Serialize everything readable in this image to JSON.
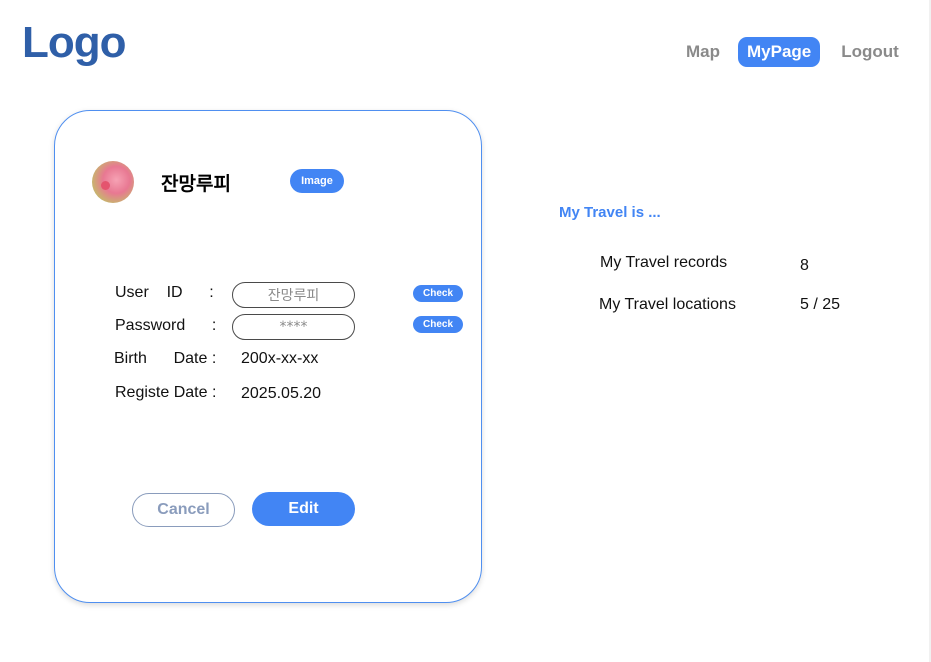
{
  "header": {
    "logo": "Logo",
    "nav": [
      "Map",
      "MyPage",
      "Logout"
    ]
  },
  "profile": {
    "name": "잔망루피",
    "image_button": "Image",
    "fields": {
      "user_id_label": "User    ID      :",
      "user_id_value": "잔망루피",
      "password_label": "Password      :",
      "password_value": "****",
      "birth_label": "Birth      Date :",
      "birth_value": "200x-xx-xx",
      "register_label": "Registe Date :",
      "register_value": "2025.05.20"
    },
    "check_label": "Check",
    "cancel_label": "Cancel",
    "edit_label": "Edit"
  },
  "travel": {
    "title": "My Travel is ...",
    "records_label": "My Travel records",
    "records_value": "8",
    "locations_label": "My Travel locations",
    "locations_value": "5 / 25"
  },
  "colors": {
    "accent": "#4285f4",
    "logo": "#2f5fa8",
    "nav_inactive": "#8a8a8a",
    "card_border": "#4f8ff0"
  }
}
